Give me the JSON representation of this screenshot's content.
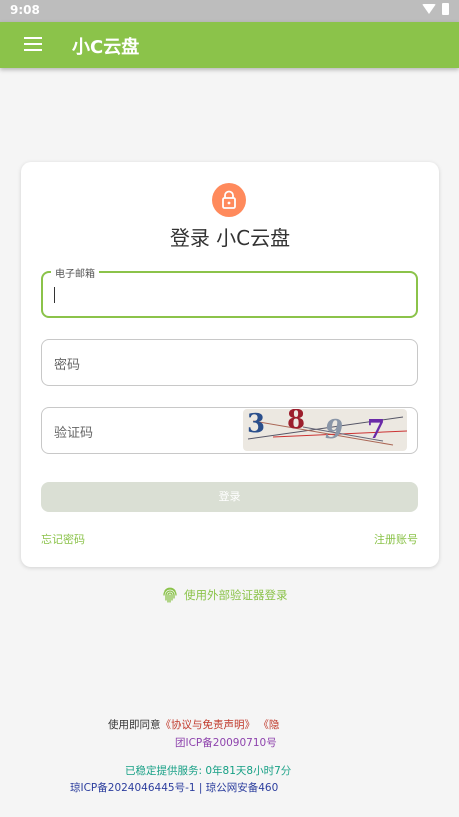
{
  "status_bar": {
    "time": "9:08"
  },
  "app_bar": {
    "title": "小C云盘",
    "menu_icon": "hamburger-menu-icon"
  },
  "login_card": {
    "icon": "lock-icon",
    "title": "登录 小C云盘",
    "email": {
      "label": "电子邮箱",
      "value": ""
    },
    "password": {
      "placeholder": "密码"
    },
    "captcha": {
      "placeholder": "验证码",
      "chars": [
        "3",
        "8",
        "9",
        "7"
      ]
    },
    "submit_label": "登录",
    "forgot_password": "忘记密码",
    "register": "注册账号"
  },
  "external_login": {
    "icon": "fingerprint-icon",
    "label": "使用外部验证器登录"
  },
  "footer": {
    "agree_prefix": "使用即同意",
    "agreement_link": "《协议与免责声明》",
    "privacy_link": "《隐",
    "icp_line": "团ICP备20090710号",
    "uptime": "已稳定提供服务: 0年81天8小时7分",
    "registration": "琼ICP备2024046445号-1  |  琼公网安备460"
  },
  "colors": {
    "primary": "#8bc34a",
    "lock_bg": "#ff8a5c",
    "button_disabled": "#dadfd4"
  }
}
